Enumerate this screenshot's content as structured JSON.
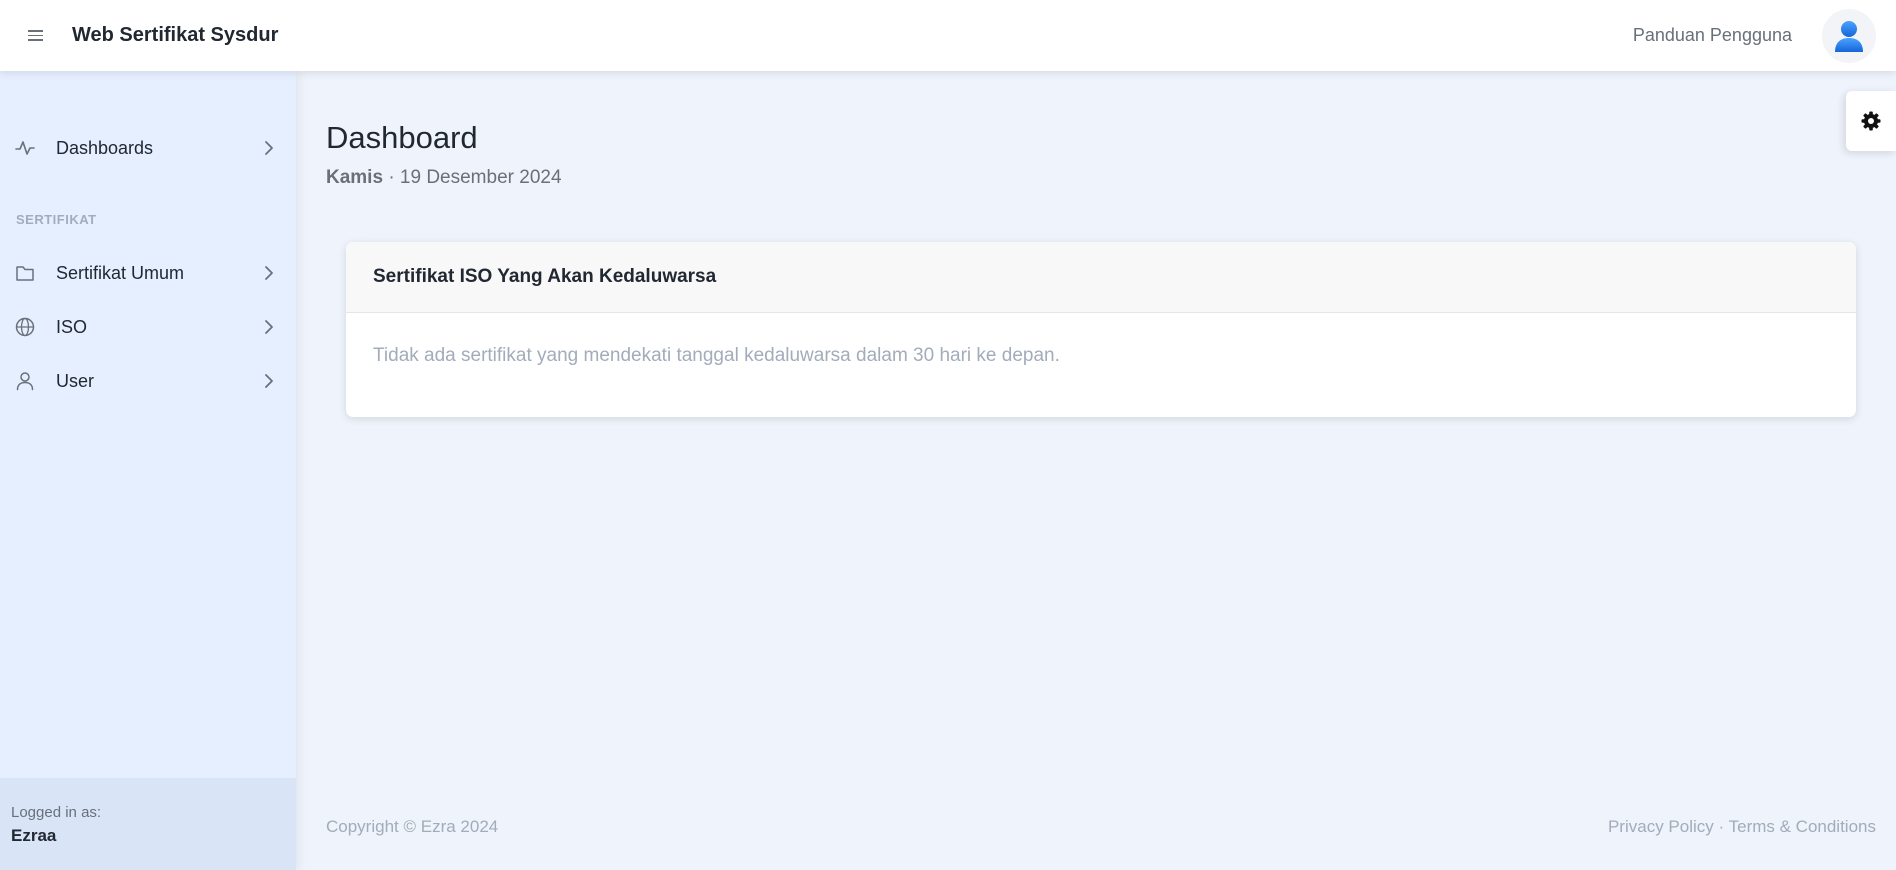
{
  "header": {
    "brand": "Web Sertifikat Sysdur",
    "guide_link": "Panduan Pengguna",
    "menu_icon": "hamburger-icon",
    "avatar_icon": "user-avatar-icon",
    "accent_color": "#2f80ed"
  },
  "sidebar": {
    "items": [
      {
        "label": "Dashboards",
        "icon": "activity-icon"
      },
      {
        "label": "Sertifikat Umum",
        "icon": "folder-icon"
      },
      {
        "label": "ISO",
        "icon": "globe-icon"
      },
      {
        "label": "User",
        "icon": "user-icon"
      }
    ],
    "section_heading": "SERTIFIKAT",
    "footer": {
      "logged_in_label": "Logged in as:",
      "username": "Ezraa"
    }
  },
  "main": {
    "title": "Dashboard",
    "day": "Kamis",
    "date": "· 19 Desember 2024",
    "card": {
      "title": "Sertifikat ISO Yang Akan Kedaluwarsa",
      "empty_message": "Tidak ada sertifikat yang mendekati tanggal kedaluwarsa dalam 30 hari ke depan."
    }
  },
  "footer": {
    "copyright": "Copyright © Ezra 2024",
    "privacy": "Privacy Policy",
    "separator": "·",
    "terms": "Terms & Conditions"
  },
  "settings_icon": "gear-icon"
}
